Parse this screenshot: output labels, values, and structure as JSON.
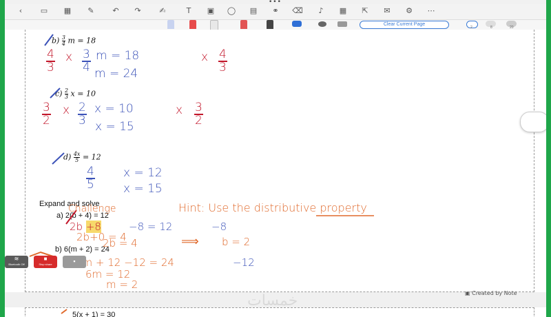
{
  "window": {
    "dots": "•••"
  },
  "toolbar": {
    "icons": [
      "back-icon",
      "sidebar-icon",
      "grid-icon",
      "lasso-icon",
      "undo-icon",
      "redo-icon",
      "pen-tool-icon",
      "text-icon",
      "image-icon",
      "shape-icon",
      "highlight-icon",
      "link-icon",
      "eraser-icon",
      "mic-icon",
      "grid-view-icon",
      "export-icon",
      "comment-icon",
      "settings-icon",
      "more-icon"
    ],
    "glyphs": [
      "‹",
      "▭",
      "▦",
      "✎",
      "↶",
      "↷",
      "✍",
      "T",
      "▣",
      "◯",
      "▤",
      "⚭",
      "⌫",
      "♪",
      "▦",
      "⇱",
      "✉",
      "⚙",
      "⋯"
    ]
  },
  "subbar": {
    "clear_label": "Clear Current Page",
    "sizes": [
      "2",
      "8",
      "20"
    ],
    "accent": "#3a7bd5"
  },
  "worksheet": {
    "b_label": "b)",
    "b_num": "3",
    "b_den": "4",
    "b_rest": "m = 18",
    "c_label": "c)",
    "c_num": "2",
    "c_den": "3",
    "c_rest": "x = 10",
    "d_label": "d)",
    "d_num": "4x",
    "d_den": "5",
    "d_rest": "= 12",
    "section_title": "Expand and solve",
    "a_expr": "a) 2(b + 4) = 12",
    "b2_expr": "b) 6(m + 2) = 24",
    "next_expr": "5(x + 1) = 30"
  },
  "handwriting": {
    "b_line1_f1_num": "4",
    "b_line1_f1_den": "3",
    "b_line1_x1": "x",
    "b_line1_f2_num": "3",
    "b_line1_f2_den": "4",
    "b_line1_mid": "m   = 18",
    "b_line1_x2": "x",
    "b_line1_f3_num": "4",
    "b_line1_f3_den": "3",
    "b_line2": "m = 24",
    "c_line1_f1_num": "3",
    "c_line1_f1_den": "2",
    "c_line1_x1": "x",
    "c_line1_f2_num": "2",
    "c_line1_f2_den": "3",
    "c_line1_mid": "x = 10",
    "c_line1_x2": "x",
    "c_line1_f3_num": "3",
    "c_line1_f3_den": "2",
    "c_line2": "x = 15",
    "d_line1_num": "4",
    "d_line1_den": "5",
    "d_line1_rest": "x   = 12",
    "d_line2": "x   = 15",
    "challenge": "Challenge",
    "hint": "Hint: Use the",
    "hint_underlined": "distributive",
    "hint_end": "property",
    "a_step1a": "2b",
    "a_step1b": "+8",
    "a_step1c": "−8 = 12",
    "a_step1d": "−8",
    "a_step2": "2b+0 = 4",
    "a_step3": "2b = 4",
    "a_arrow": "⟹",
    "a_answer": "b = 2",
    "b_step1a": "6m + 12 −12 = 24",
    "b_step1b": "−12",
    "b_step2": "6m = 12",
    "b_step3": "m = 2"
  },
  "footer": {
    "created_by": "Created by Note"
  },
  "watermark": "خمسات",
  "widgets": {
    "w1": "Bluetooth\nOff",
    "w2": "Stop\nshare",
    "colors": [
      "#5a5a5a",
      "#d62b2b",
      "#9a9a9a"
    ]
  }
}
